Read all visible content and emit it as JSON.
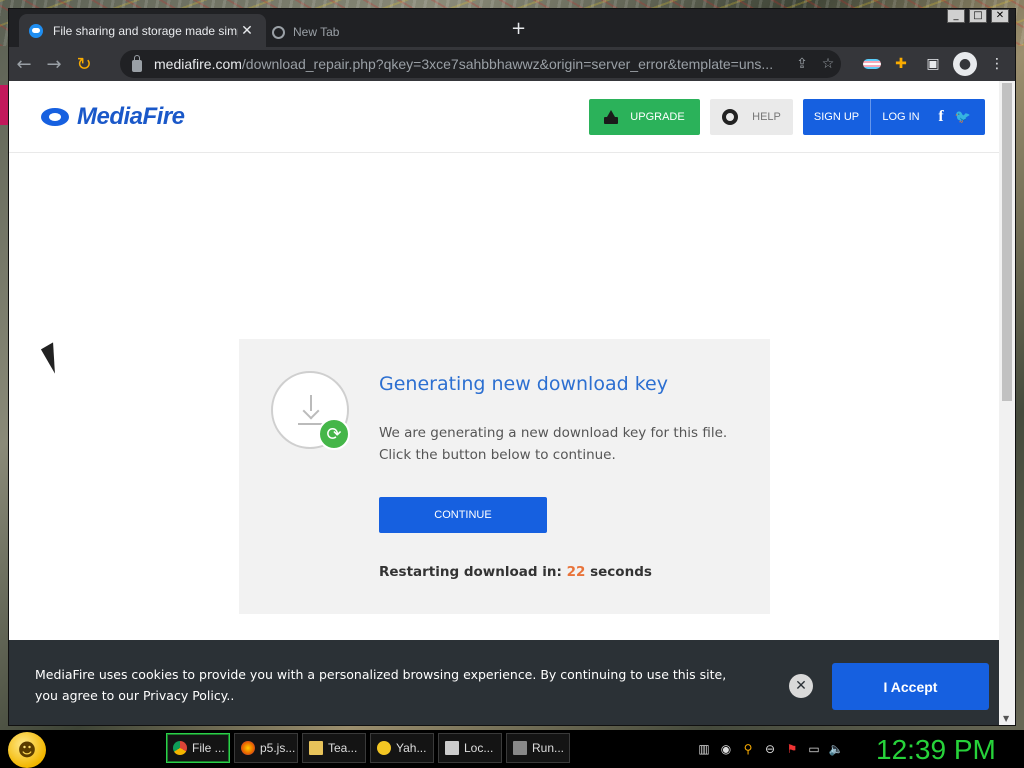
{
  "browser": {
    "active_tab_title": "File sharing and storage made simple",
    "second_tab_title": "New Tab",
    "url_host": "mediafire.com",
    "url_path": "/download_repair.php?qkey=3xce7sahbbhawwz&origin=server_error&template=uns..."
  },
  "header": {
    "logo_text": "MediaFire",
    "upgrade_label": "UPGRADE",
    "help_label": "HELP",
    "signup_label": "SIGN UP",
    "login_label": "LOG IN",
    "facebook_glyph": "f",
    "twitter_glyph": "🐦"
  },
  "card": {
    "title": "Generating new download key",
    "desc_line1": "We are generating a new download key for this file.",
    "desc_line2": "Click the button below to continue.",
    "continue_label": "CONTINUE",
    "restart_prefix": "Restarting download in:",
    "restart_seconds": "22",
    "restart_suffix": "seconds"
  },
  "cookie": {
    "message": "MediaFire uses cookies to provide you with a personalized browsing experience. By continuing to use this site, you agree to our Privacy Policy..",
    "close_glyph": "✕",
    "accept_label": "I Accept"
  },
  "taskbar": {
    "tasks": [
      {
        "label": "File ...",
        "color": "#dfe3e8"
      },
      {
        "label": "p5.js...",
        "color": "#e66000"
      },
      {
        "label": "Tea...",
        "color": "#e8c35a"
      },
      {
        "label": "Yah...",
        "color": "#f3c623"
      },
      {
        "label": "Loc...",
        "color": "#cccccc"
      },
      {
        "label": "Run...",
        "color": "#888888"
      }
    ],
    "clock": "12:39 PM"
  },
  "colors": {
    "brand_blue": "#1660e0",
    "upgrade_green": "#2bb25a",
    "countdown_orange": "#e8733a",
    "clock_green": "#27d23a"
  }
}
